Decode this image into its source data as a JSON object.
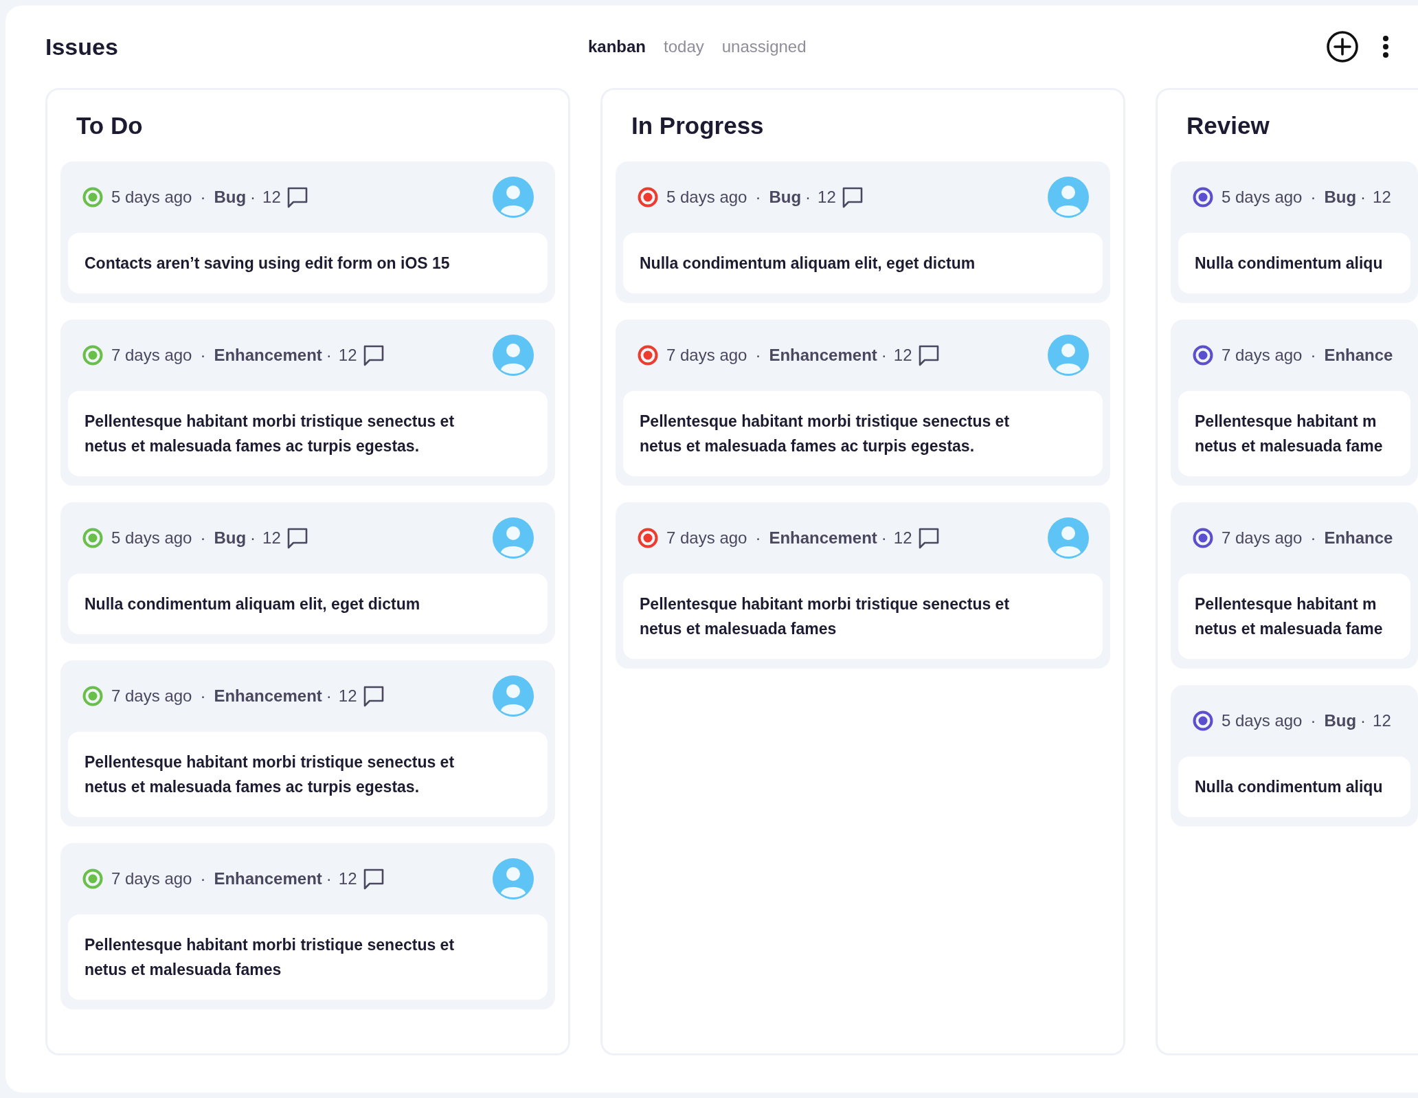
{
  "title": "Issues",
  "tabs": [
    {
      "label": "kanban",
      "selected": true
    },
    {
      "label": "today",
      "selected": false
    },
    {
      "label": "unassigned",
      "selected": false
    }
  ],
  "columns": [
    {
      "title": "To Do",
      "color": "#6abf4b",
      "cards": [
        {
          "age": "5 days ago",
          "sep_1": "·",
          "category": "Bug",
          "sep_2": "·",
          "comments": "12",
          "comment_icon": true,
          "avatar": true,
          "text": "Contacts aren’t saving using edit form on iOS 15"
        },
        {
          "age": "7 days ago",
          "sep_1": "·",
          "category": "Enhancement",
          "sep_2": "·",
          "comments": "12",
          "comment_icon": true,
          "avatar": true,
          "text": "Pellentesque habitant morbi tristique senectus et\nnetus et malesuada fames ac turpis egestas."
        },
        {
          "age": "5 days ago",
          "sep_1": "·",
          "category": "Bug",
          "sep_2": "·",
          "comments": "12",
          "comment_icon": true,
          "avatar": true,
          "text": "Nulla condimentum aliquam elit, eget dictum"
        },
        {
          "age": "7 days ago",
          "sep_1": "·",
          "category": "Enhancement",
          "sep_2": "·",
          "comments": "12",
          "comment_icon": true,
          "avatar": true,
          "text": "Pellentesque habitant morbi tristique senectus et\nnetus et malesuada fames ac turpis egestas."
        },
        {
          "age": "7 days ago",
          "sep_1": "·",
          "category": "Enhancement",
          "sep_2": "·",
          "comments": "12",
          "comment_icon": true,
          "avatar": true,
          "text": "Pellentesque habitant morbi tristique senectus et\nnetus et malesuada fames"
        }
      ]
    },
    {
      "title": "In Progress",
      "color": "#ef3b2d",
      "cards": [
        {
          "age": "5 days ago",
          "sep_1": "·",
          "category": "Bug",
          "sep_2": "·",
          "comments": "12",
          "comment_icon": true,
          "avatar": true,
          "text": "Nulla condimentum aliquam elit, eget dictum"
        },
        {
          "age": "7 days ago",
          "sep_1": "·",
          "category": "Enhancement",
          "sep_2": "·",
          "comments": "12",
          "comment_icon": true,
          "avatar": true,
          "text": "Pellentesque habitant morbi tristique senectus et\nnetus et malesuada fames ac turpis egestas."
        },
        {
          "age": "7 days ago",
          "sep_1": "·",
          "category": "Enhancement",
          "sep_2": "·",
          "comments": "12",
          "comment_icon": true,
          "avatar": true,
          "text": "Pellentesque habitant morbi tristique senectus et\nnetus et malesuada fames"
        }
      ]
    },
    {
      "title": "Review",
      "color": "#5b4fcf",
      "cards": [
        {
          "age": "5 days ago",
          "sep_1": "·",
          "category": "Bug",
          "sep_2": "·",
          "comments": "12",
          "comment_icon": false,
          "avatar": false,
          "text": "Nulla condimentum aliqu"
        },
        {
          "age": "7 days ago",
          "sep_1": "·",
          "category": "Enhance",
          "comment_icon": false,
          "avatar": false,
          "text": "Pellentesque habitant m\nnetus et malesuada fame"
        },
        {
          "age": "7 days ago",
          "sep_1": "·",
          "category": "Enhance",
          "comment_icon": false,
          "avatar": false,
          "text": "Pellentesque habitant m\nnetus et malesuada fame"
        },
        {
          "age": "5 days ago",
          "sep_1": "·",
          "category": "Bug",
          "sep_2": "·",
          "comments": "12",
          "comment_icon": false,
          "avatar": false,
          "text": "Nulla condimentum aliqu"
        }
      ]
    }
  ]
}
